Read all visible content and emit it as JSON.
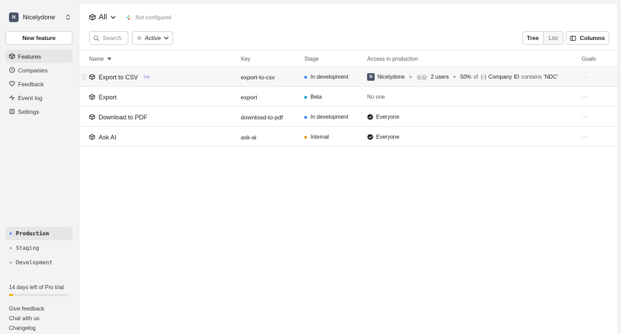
{
  "org": {
    "initial": "N",
    "name": "Nicelydone"
  },
  "sidebar": {
    "new_feature_label": "New feature",
    "items": [
      {
        "label": "Features",
        "icon": "features-icon",
        "active": true
      },
      {
        "label": "Companies",
        "icon": "companies-icon",
        "active": false
      },
      {
        "label": "Feedback",
        "icon": "feedback-icon",
        "active": false
      },
      {
        "label": "Event log",
        "icon": "event-log-icon",
        "active": false
      },
      {
        "label": "Settings",
        "icon": "settings-icon",
        "active": false
      }
    ],
    "environments": [
      {
        "label": "Production",
        "active": true,
        "color": "#3b82f6"
      },
      {
        "label": "Staging",
        "active": false,
        "color": "#9ca3af"
      },
      {
        "label": "Development",
        "active": false,
        "color": "#9ca3af"
      }
    ],
    "trial": {
      "text": "14 days left of Pro trial",
      "progress": 0.07,
      "color": "#f5b400"
    },
    "footer_links": [
      "Give feedback",
      "Chat with us",
      "Changelog"
    ]
  },
  "header": {
    "scope_label": "All",
    "integration_status": "Not configured"
  },
  "toolbar": {
    "search_placeholder": "Search",
    "filter_label": "Active",
    "view_tree": "Tree",
    "view_list": "List",
    "columns_label": "Columns"
  },
  "table": {
    "columns": {
      "name": "Name",
      "key": "Key",
      "stage": "Stage",
      "access": "Access in production",
      "goals": "Goals"
    },
    "rows": [
      {
        "name": "Export to CSV",
        "key": "export-to-csv",
        "stage": "In development",
        "stage_color": "#3b82f6",
        "access": {
          "company_initial": "N",
          "company": "Nicelydone",
          "plus1": "+",
          "user_initials": [
            "?",
            "?"
          ],
          "users": "2 users",
          "plus2": "+",
          "percent": "50%",
          "of": "of",
          "attr_icon": "{-}",
          "attr": "Company ID",
          "op": "contains",
          "value": "'NDC'"
        },
        "goals": "—"
      },
      {
        "name": "Export",
        "key": "export",
        "stage": "Beta",
        "stage_color": "#14a3c7",
        "access_text": "No one",
        "goals": "—"
      },
      {
        "name": "Download to PDF",
        "key": "download-to-pdf",
        "stage": "In development",
        "stage_color": "#3b82f6",
        "access_text": "Everyone",
        "goals": "—"
      },
      {
        "name": "Ask AI",
        "key": "ask-ai",
        "stage": "Internal",
        "stage_color": "#f59e0b",
        "access_text": "Everyone",
        "goals": "—"
      }
    ]
  }
}
